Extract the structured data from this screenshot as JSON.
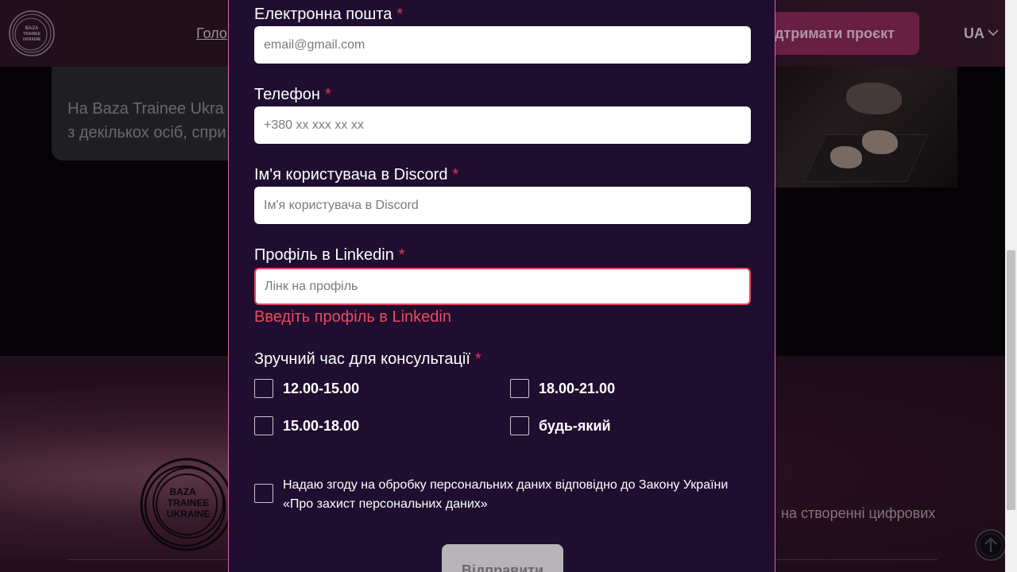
{
  "header": {
    "logo_text": "BAZA TRAINEE UKRAINE",
    "nav_home": "Голо",
    "support_button": "ідтримати проєкт",
    "language": "UA"
  },
  "background": {
    "info_line1": "На Baza Trainee Ukra",
    "info_line2": "з декількох осіб, спри",
    "bottom_text": "на створенні цифрових",
    "footer_logo_text": "BAZA TRAINEE UKRAINE"
  },
  "form": {
    "email": {
      "label": "Електронна пошта",
      "required": "*",
      "placeholder": "email@gmail.com",
      "value": ""
    },
    "phone": {
      "label": "Телефон",
      "required": "*",
      "placeholder": "+380 xx xxx xx xx",
      "value": ""
    },
    "discord": {
      "label": "Ім'я користувача в Discord",
      "required": "*",
      "placeholder": "Ім'я користувача в Discord",
      "value": ""
    },
    "linkedin": {
      "label": "Профіль в Linkedin",
      "required": "*",
      "placeholder": "Лінк на профіль",
      "value": "",
      "error": "Введіть профіль в Linkedin"
    },
    "time": {
      "label": "Зручний час для консультації",
      "required": "*",
      "options": [
        "12.00-15.00",
        "18.00-21.00",
        "15.00-18.00",
        "будь-який"
      ]
    },
    "consent": "Надаю згоду на обробку персональних даних відповідно до Закону України «Про захист персональних даних»",
    "submit": "Відправити"
  },
  "colors": {
    "modal_bg": "#1f0e2f",
    "modal_border": "#d46aa6",
    "required": "#e53950",
    "error": "#ec4a5f",
    "submit_bg": "#b7b4b8"
  }
}
